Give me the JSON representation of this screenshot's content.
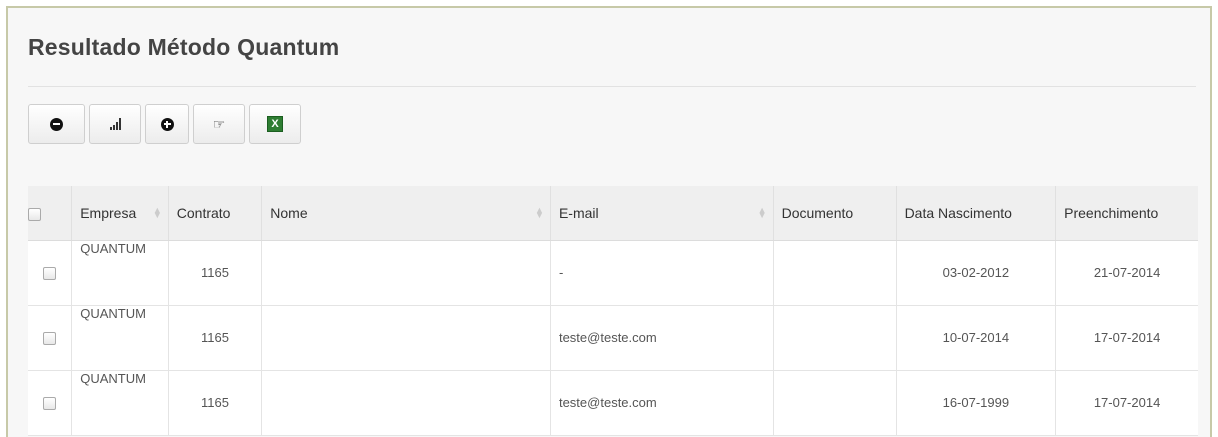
{
  "page": {
    "title": "Resultado Método Quantum"
  },
  "toolbar": {
    "buttons": [
      {
        "icon": "minus-circle-icon"
      },
      {
        "icon": "signal-bars-icon"
      },
      {
        "icon": "plus-circle-icon"
      },
      {
        "icon": "hand-pointer-icon"
      },
      {
        "icon": "excel-icon",
        "glyph": "X"
      }
    ]
  },
  "table": {
    "headers": {
      "empresa": "Empresa",
      "contrato": "Contrato",
      "nome": "Nome",
      "email": "E-mail",
      "documento": "Documento",
      "nascimento": "Data Nascimento",
      "preenchimento": "Preenchimento"
    },
    "rows": [
      {
        "empresa": "QUANTUM",
        "contrato": "1165",
        "nome": "",
        "email": "-",
        "documento": "",
        "nascimento": "03-02-2012",
        "preenchimento": "21-07-2014"
      },
      {
        "empresa": "QUANTUM",
        "contrato": "1165",
        "nome": "",
        "email": "teste@teste.com",
        "documento": "",
        "nascimento": "10-07-2014",
        "preenchimento": "17-07-2014"
      },
      {
        "empresa": "QUANTUM",
        "contrato": "1165",
        "nome": "",
        "email": "teste@teste.com",
        "documento": "",
        "nascimento": "16-07-1999",
        "preenchimento": "17-07-2014"
      }
    ]
  },
  "colors": {
    "frame_border": "#c7c9a8",
    "header_bg": "#efefef",
    "excel_green": "#2e7d32"
  }
}
